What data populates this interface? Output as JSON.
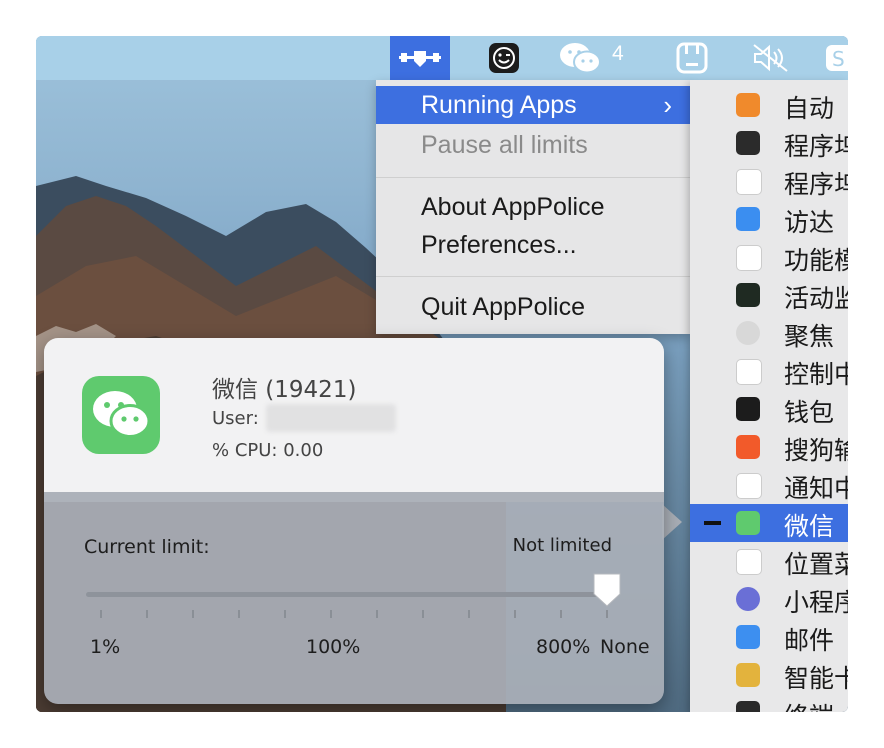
{
  "menubar": {
    "wechat_badge_count": "4",
    "icons": [
      "apppolice-icon",
      "wink-face-icon",
      "wechat-icon",
      "bag-icon",
      "mute-speaker-icon",
      "sogou-icon"
    ]
  },
  "menu": {
    "items": [
      {
        "label": "Running Apps",
        "selected": true,
        "has_submenu": true
      },
      {
        "label": "Pause all limits",
        "disabled": true
      },
      {
        "label": "About AppPolice"
      },
      {
        "label": "Preferences..."
      },
      {
        "label": "Quit AppPolice"
      }
    ],
    "submenu_chevron": "›"
  },
  "submenu": {
    "items": [
      {
        "label": "自动",
        "icon": "pages-icon",
        "color": "#f08a2c"
      },
      {
        "label": "程序坞",
        "icon": "terminal-screen-icon",
        "color": "#2b2b2b"
      },
      {
        "label": "程序坞",
        "icon": "shield-icon",
        "color": "#ffffff"
      },
      {
        "label": "访达",
        "icon": "finder-icon",
        "color": "#3b8ef0"
      },
      {
        "label": "功能模",
        "icon": "generic-app-icon",
        "color": "#ffffff"
      },
      {
        "label": "活动监",
        "icon": "activity-monitor-icon",
        "color": "#1f2a22"
      },
      {
        "label": "聚焦",
        "icon": "magnifier-icon",
        "color": "#d8d8d8"
      },
      {
        "label": "控制中",
        "icon": "control-center-icon",
        "color": "#ffffff"
      },
      {
        "label": "钱包",
        "icon": "wallet-icon",
        "color": "#1c1c1c"
      },
      {
        "label": "搜狗输",
        "icon": "sogou-icon",
        "color": "#f25a2a"
      },
      {
        "label": "通知中",
        "icon": "generic-app-icon",
        "color": "#ffffff"
      },
      {
        "label": "微信",
        "icon": "wechat-icon",
        "color": "#5fca6e",
        "selected": true
      },
      {
        "label": "位置菜",
        "icon": "generic-app-icon",
        "color": "#ffffff"
      },
      {
        "label": "小程序",
        "icon": "miniprogram-icon",
        "color": "#6a6fd6"
      },
      {
        "label": "邮件",
        "icon": "mail-icon",
        "color": "#3d8ff0"
      },
      {
        "label": "智能卡",
        "icon": "smartcard-icon",
        "color": "#e3b33d"
      },
      {
        "label": "终端",
        "icon": "terminal-icon",
        "color": "#2a2a2a"
      }
    ]
  },
  "popup": {
    "app_title": "微信 (19421)",
    "user_label": "User:",
    "cpu_text": "% CPU: 0.00",
    "limit_label": "Current limit:",
    "limit_value": "Not limited",
    "slider_position": "None",
    "scale_labels": [
      "1%",
      "100%",
      "800%",
      "None"
    ]
  },
  "colors": {
    "accent": "#3d6fe0",
    "wechat_green": "#5fca6e",
    "menu_bg": "#e6e6e7"
  }
}
